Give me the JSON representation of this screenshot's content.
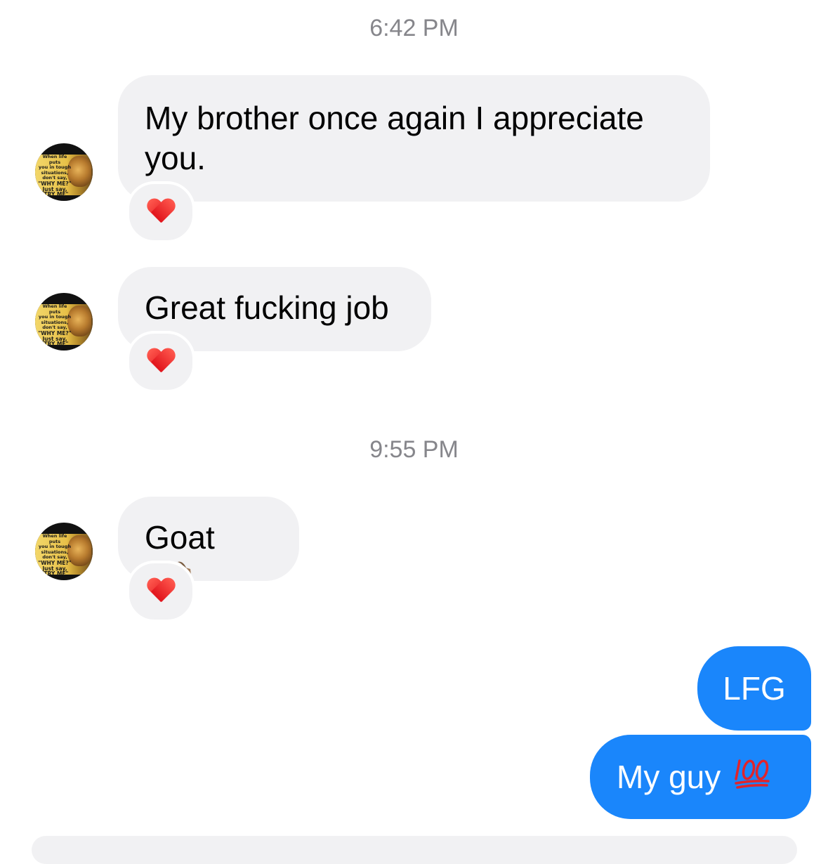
{
  "conversation": {
    "timestamps": [
      "6:42 PM",
      "9:55 PM"
    ],
    "messages": [
      {
        "direction": "incoming",
        "text": "My brother once again I appreciate you.",
        "reaction": "red-heart"
      },
      {
        "direction": "incoming",
        "text": "Great fucking job",
        "reaction": "red-heart"
      },
      {
        "direction": "incoming",
        "text": "Goat",
        "emoji": "goat",
        "reaction": "red-heart"
      },
      {
        "direction": "outgoing",
        "text": "LFG"
      },
      {
        "direction": "outgoing",
        "text": "My guy",
        "emoji": "hundred-points"
      }
    ]
  },
  "avatar": {
    "quote_lines": [
      "When life puts",
      "you in tough",
      "situations,",
      "don't say,",
      "\"WHY ME?\"",
      "Just say, \"TRY ME\""
    ]
  },
  "colors": {
    "incoming_bubble": "#f1f1f3",
    "outgoing_bubble": "#1a86fb",
    "timestamp": "#86868b",
    "heart": "#e1141c"
  }
}
